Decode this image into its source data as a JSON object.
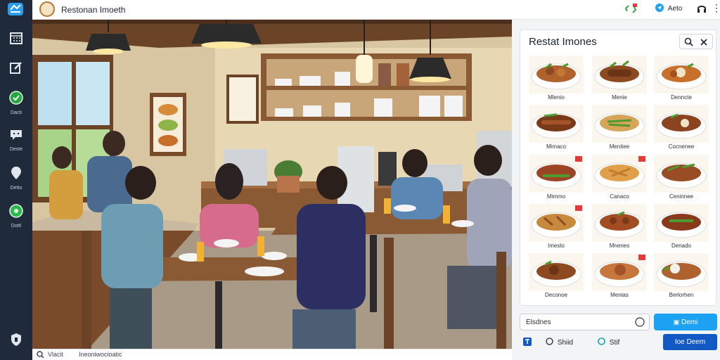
{
  "header": {
    "title": "Restonan Imoeth",
    "right_items": [
      "Aeto"
    ]
  },
  "sidebar": {
    "items": [
      {
        "icon": "calendar-icon",
        "label": ""
      },
      {
        "icon": "edit-icon",
        "label": ""
      },
      {
        "icon": "check-circle-icon",
        "label": "Dacti"
      },
      {
        "icon": "chat-icon",
        "label": "Deste"
      },
      {
        "icon": "pin-icon",
        "label": "Detto"
      },
      {
        "icon": "green-dot-icon",
        "label": "Dotti"
      }
    ]
  },
  "status_bar": {
    "left_text": "Vlacit",
    "right_text": "Ineoniwocioatic"
  },
  "panel": {
    "title": "Restat Imones",
    "tiles": [
      {
        "caption": "Mlenio"
      },
      {
        "caption": "Menie"
      },
      {
        "caption": "Denncte"
      },
      {
        "caption": "Mimaco"
      },
      {
        "caption": "Menitee"
      },
      {
        "caption": "Cocnenee"
      },
      {
        "caption": "Mimmo"
      },
      {
        "caption": "Canaco"
      },
      {
        "caption": "Ceninnee"
      },
      {
        "caption": "Imesto"
      },
      {
        "caption": "Mnenes"
      },
      {
        "caption": "Denado"
      },
      {
        "caption": "Deconoe"
      },
      {
        "caption": "Menias"
      },
      {
        "caption": "Berlorhen"
      }
    ]
  },
  "search": {
    "value": "Elsdnes"
  },
  "buttons": {
    "primary": "Demi",
    "shiid": "Shiid",
    "stif": "Stif",
    "dark": "Ioe Deem"
  },
  "colors": {
    "sidebar_bg": "#1f2a3a",
    "accent": "#1da1f2",
    "dark_button": "#1259c4"
  }
}
